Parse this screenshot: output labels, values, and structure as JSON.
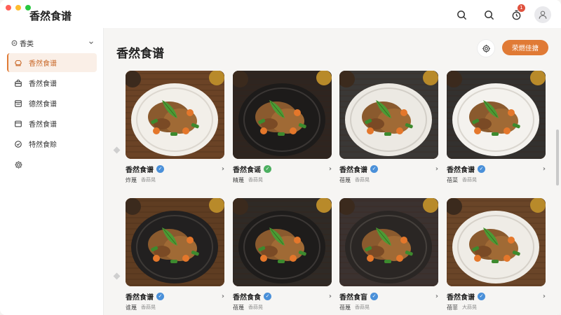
{
  "app": {
    "title": "香然食谱"
  },
  "topbar": {
    "icons": [
      "search-icon",
      "search-icon",
      "alarm-icon",
      "user-icon"
    ],
    "notification_count": "1"
  },
  "sidebar": {
    "header": "香类",
    "items": [
      {
        "label": "香然食谱",
        "icon": "chef-icon",
        "active": true
      },
      {
        "label": "香然食谱",
        "icon": "bag-icon",
        "active": false
      },
      {
        "label": "德然食谱",
        "icon": "book-icon",
        "active": false
      },
      {
        "label": "香然食谱",
        "icon": "card-icon",
        "active": false
      },
      {
        "label": "特然食赊",
        "icon": "check-circle-icon",
        "active": false
      }
    ]
  },
  "main": {
    "title": "香然食谱",
    "cta_label": "荣燃佳搪"
  },
  "cards": [
    {
      "title": "香然食谱",
      "badge": "blue",
      "meta1": "炸蔑",
      "meta2": "香蒜晃"
    },
    {
      "title": "香然食谣",
      "badge": "green",
      "meta1": "精蔑",
      "meta2": "香蒜晃"
    },
    {
      "title": "香然食谱",
      "badge": "blue",
      "meta1": "蓓蔑",
      "meta2": "香蒜晃"
    },
    {
      "title": "香然食谱",
      "badge": "blue",
      "meta1": "蓓菜",
      "meta2": "香蒜晃"
    },
    {
      "title": "香然食谱",
      "badge": "blue",
      "meta1": "谁蔑",
      "meta2": "香蒜晃"
    },
    {
      "title": "香然食食",
      "badge": "blue",
      "meta1": "蓓蔑",
      "meta2": "香蒜晃"
    },
    {
      "title": "香然食盲",
      "badge": "blue",
      "meta1": "蓓蔑",
      "meta2": "香蒜晃"
    },
    {
      "title": "香然食谱",
      "badge": "blue",
      "meta1": "蓓菲",
      "meta2": "大蒜晃"
    }
  ]
}
